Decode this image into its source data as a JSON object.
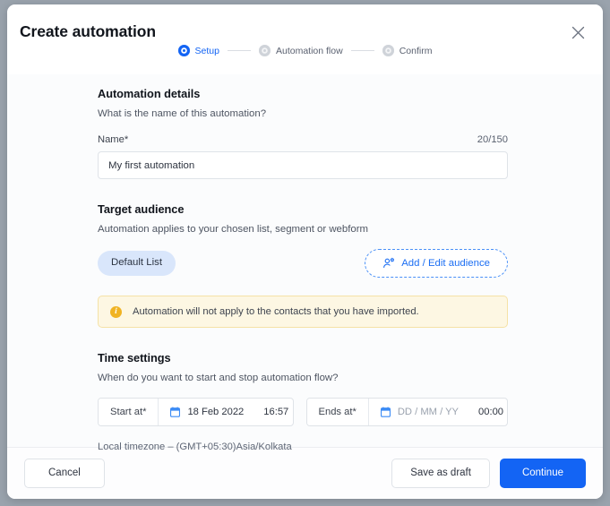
{
  "header": {
    "title": "Create automation",
    "close_icon": "close-icon"
  },
  "stepper": {
    "steps": [
      {
        "label": "Setup",
        "state": "active"
      },
      {
        "label": "Automation flow",
        "state": "inactive"
      },
      {
        "label": "Confirm",
        "state": "inactive"
      }
    ]
  },
  "automation_details": {
    "title": "Automation details",
    "subtitle": "What is the name of this automation?",
    "name_label": "Name",
    "required_marker": "*",
    "char_count": "20/150",
    "name_value": "My first automation",
    "name_placeholder": "My first automation"
  },
  "target_audience": {
    "title": "Target audience",
    "subtitle": "Automation applies to your chosen list, segment or webform",
    "chip_label": "Default List",
    "add_button_label": "Add / Edit audience",
    "add_button_icon": "user-settings-icon"
  },
  "warning": {
    "icon": "info-icon",
    "text": "Automation will not apply to the contacts that you have imported."
  },
  "time_settings": {
    "title": "Time settings",
    "subtitle": "When do you want to start and stop automation flow?",
    "start": {
      "label": "Start at",
      "required_marker": "*",
      "date_value": "18 Feb 2022",
      "date_placeholder": "DD / MM / YY",
      "time_value": "16:57",
      "calendar_icon": "calendar-icon"
    },
    "end": {
      "label": "Ends at",
      "required_marker": "*",
      "date_value": "DD / MM / YY",
      "date_placeholder": "DD / MM / YY",
      "time_value": "00:00",
      "calendar_icon": "calendar-icon"
    },
    "timezone": "Local timezone – (GMT+05:30)Asia/Kolkata"
  },
  "footer": {
    "cancel_label": "Cancel",
    "save_draft_label": "Save as draft",
    "continue_label": "Continue"
  },
  "colors": {
    "accent_blue": "#1364f4",
    "chip_blue": "#d9e6fb",
    "warning_bg": "#fdf7e3",
    "warning_border": "#f5e2a6",
    "warning_icon": "#f0b323"
  }
}
